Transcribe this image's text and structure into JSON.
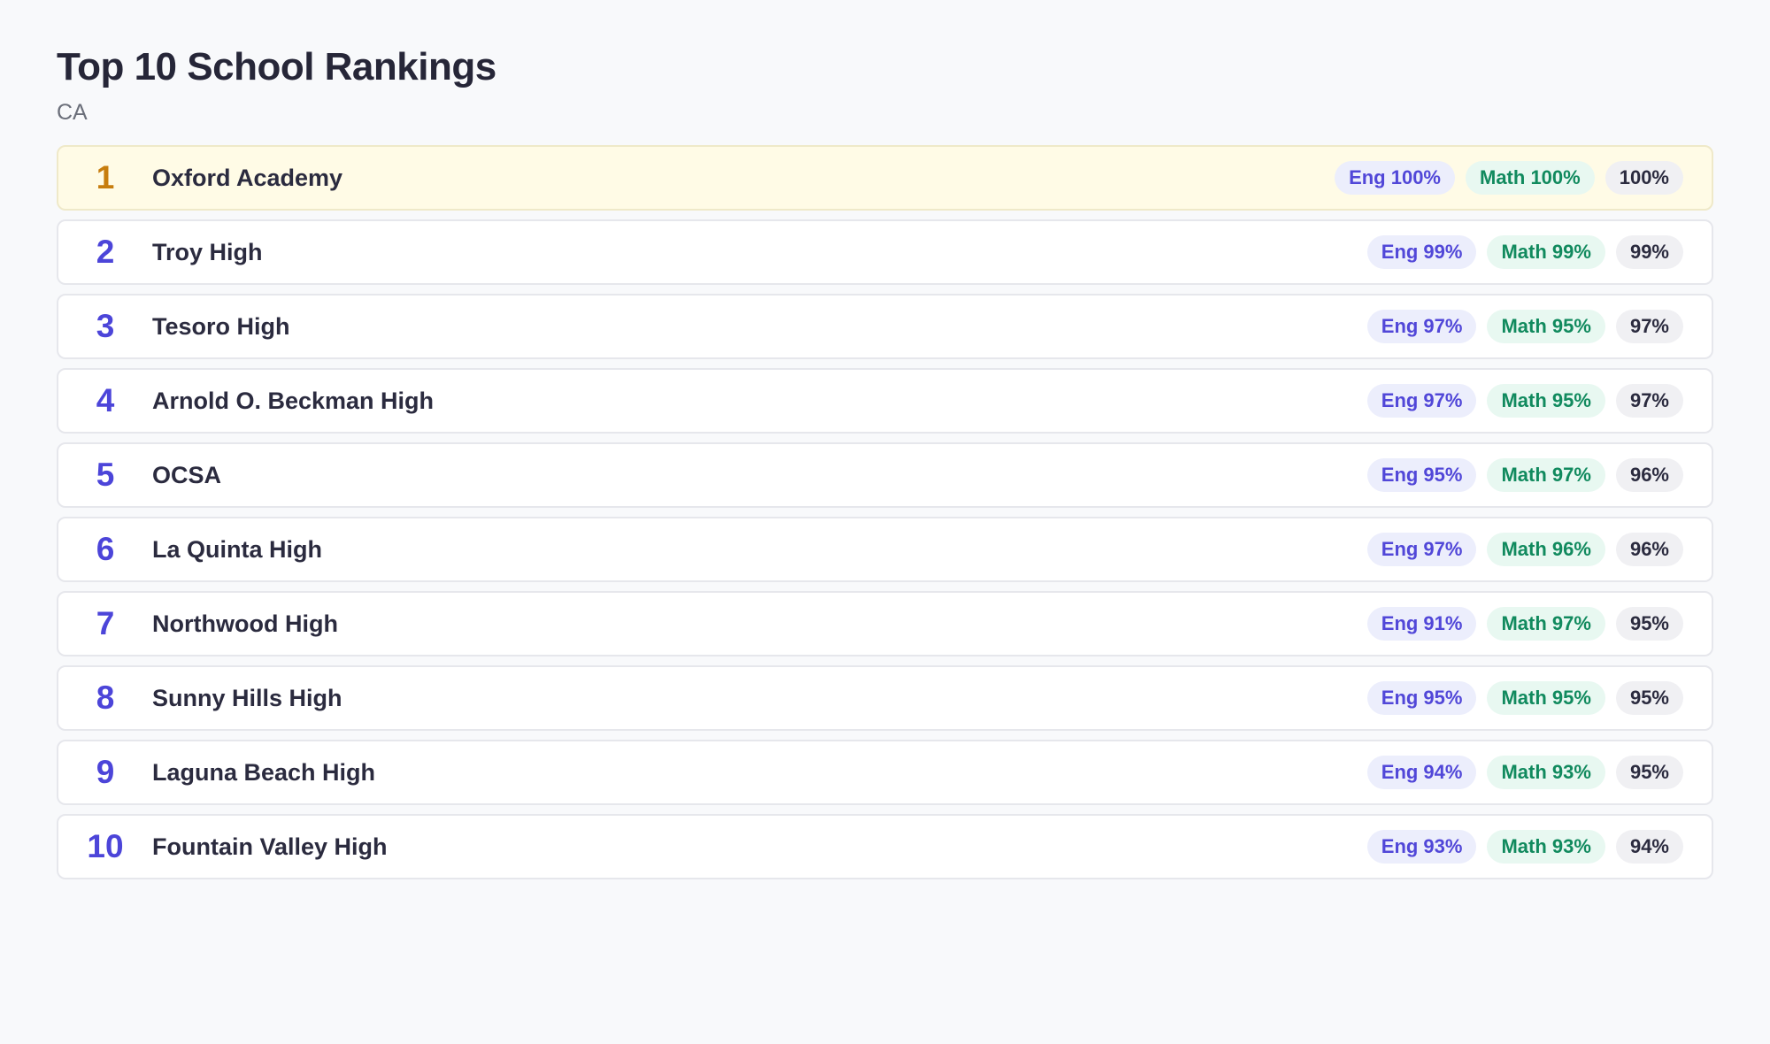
{
  "header": {
    "title": "Top 10 School Rankings",
    "subtitle": "CA"
  },
  "colors": {
    "accent": "#4c45d9",
    "top_rank": "#c77d0e",
    "eng": "#5147d8",
    "math": "#118a5e"
  },
  "schools": [
    {
      "rank": "1",
      "name": "Oxford Academy",
      "eng": "Eng 100%",
      "math": "Math 100%",
      "overall": "100%"
    },
    {
      "rank": "2",
      "name": "Troy High",
      "eng": "Eng 99%",
      "math": "Math 99%",
      "overall": "99%"
    },
    {
      "rank": "3",
      "name": "Tesoro High",
      "eng": "Eng 97%",
      "math": "Math 95%",
      "overall": "97%"
    },
    {
      "rank": "4",
      "name": "Arnold O. Beckman High",
      "eng": "Eng 97%",
      "math": "Math 95%",
      "overall": "97%"
    },
    {
      "rank": "5",
      "name": "OCSA",
      "eng": "Eng 95%",
      "math": "Math 97%",
      "overall": "96%"
    },
    {
      "rank": "6",
      "name": "La Quinta High",
      "eng": "Eng 97%",
      "math": "Math 96%",
      "overall": "96%"
    },
    {
      "rank": "7",
      "name": "Northwood High",
      "eng": "Eng 91%",
      "math": "Math 97%",
      "overall": "95%"
    },
    {
      "rank": "8",
      "name": "Sunny Hills High",
      "eng": "Eng 95%",
      "math": "Math 95%",
      "overall": "95%"
    },
    {
      "rank": "9",
      "name": "Laguna Beach High",
      "eng": "Eng 94%",
      "math": "Math 93%",
      "overall": "95%"
    },
    {
      "rank": "10",
      "name": "Fountain Valley High",
      "eng": "Eng 93%",
      "math": "Math 93%",
      "overall": "94%"
    }
  ]
}
